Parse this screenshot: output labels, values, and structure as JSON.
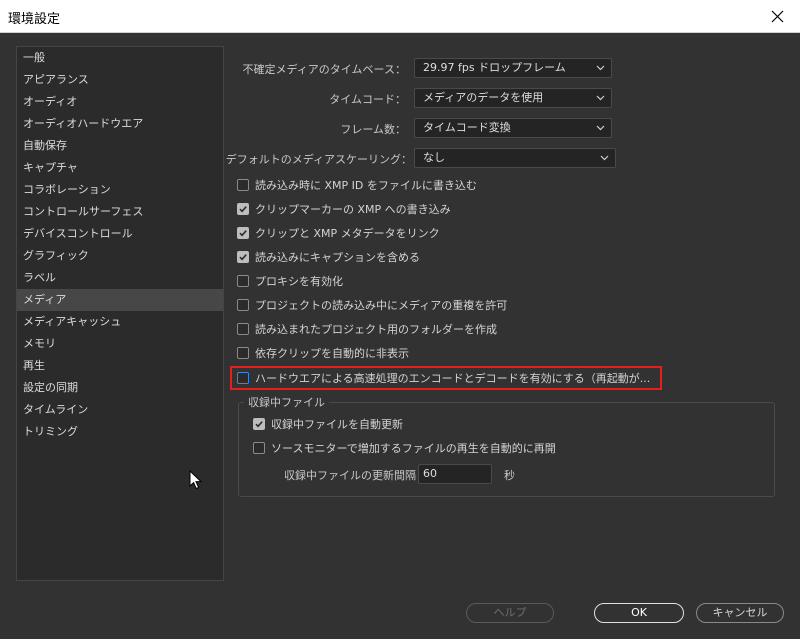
{
  "window": {
    "title": "環境設定"
  },
  "sidebar": {
    "items": [
      {
        "label": "一般"
      },
      {
        "label": "アピアランス"
      },
      {
        "label": "オーディオ"
      },
      {
        "label": "オーディオハードウエア"
      },
      {
        "label": "自動保存"
      },
      {
        "label": "キャプチャ"
      },
      {
        "label": "コラボレーション"
      },
      {
        "label": "コントロールサーフェス"
      },
      {
        "label": "デバイスコントロール"
      },
      {
        "label": "グラフィック"
      },
      {
        "label": "ラベル"
      },
      {
        "label": "メディア"
      },
      {
        "label": "メディアキャッシュ"
      },
      {
        "label": "メモリ"
      },
      {
        "label": "再生"
      },
      {
        "label": "設定の同期"
      },
      {
        "label": "タイムライン"
      },
      {
        "label": "トリミング"
      }
    ],
    "selected": "メディア"
  },
  "settings": {
    "timebase": {
      "label": "不確定メディアのタイムベース：",
      "value": "29.97  fps  ドロップフレーム"
    },
    "timecode": {
      "label": "タイムコード：",
      "value": "メディアのデータを使用"
    },
    "frame_count": {
      "label": "フレーム数：",
      "value": "タイムコード変換"
    },
    "scaling": {
      "label": "デフォルトのメディアスケーリング：",
      "value": "なし"
    }
  },
  "checkboxes": [
    {
      "label": "読み込み時に XMP ID をファイルに書き込む",
      "checked": false
    },
    {
      "label": "クリップマーカーの XMP への書き込み",
      "checked": true
    },
    {
      "label": "クリップと XMP メタデータをリンク",
      "checked": true
    },
    {
      "label": "読み込みにキャプションを含める",
      "checked": true
    },
    {
      "label": "プロキシを有効化",
      "checked": false
    },
    {
      "label": "プロジェクトの読み込み中にメディアの重複を許可",
      "checked": false
    },
    {
      "label": "読み込まれたプロジェクト用のフォルダーを作成",
      "checked": false
    },
    {
      "label": "依存クリップを自動的に非表示",
      "checked": false
    },
    {
      "label": "ハードウエアによる高速処理のエンコードとデコードを有効にする（再起動が...",
      "checked": false
    }
  ],
  "recording_group": {
    "title": "収録中ファイル",
    "auto_refresh": {
      "label": "収録中ファイルを自動更新",
      "checked": true
    },
    "auto_resume": {
      "label": "ソースモニターで増加するファイルの再生を自動的に再開",
      "checked": false
    },
    "interval_label": "収録中ファイルの更新間隔",
    "interval_value": "60",
    "interval_unit": "秒"
  },
  "buttons": {
    "help": "ヘルプ",
    "ok": "OK",
    "cancel": "キャンセル"
  },
  "colors": {
    "background": "#323232",
    "highlight": "#e3201b",
    "focus_checkbox": "#3f86d6"
  }
}
